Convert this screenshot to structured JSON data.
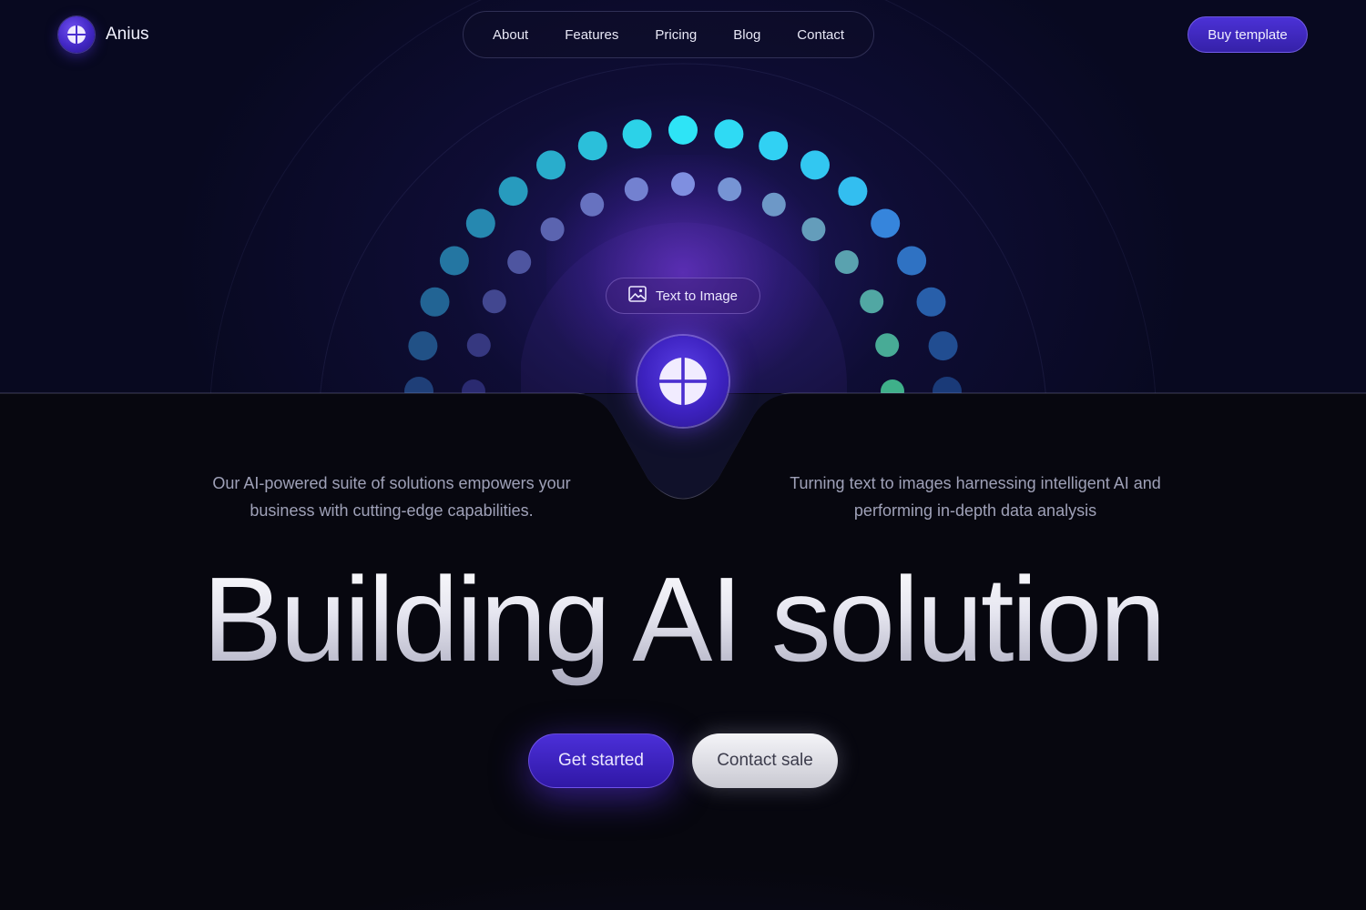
{
  "header": {
    "brand": "Anius",
    "nav": [
      "About",
      "Features",
      "Pricing",
      "Blog",
      "Contact"
    ],
    "cta": "Buy template"
  },
  "hero": {
    "badge": "Text to Image",
    "left_text": "Our AI-powered suite of solutions empowers your business with cutting-edge capabilities.",
    "right_text": "Turning text to images harnessing intelligent AI and performing in-depth data analysis",
    "headline": "Building AI solution",
    "primary_button": "Get started",
    "secondary_button": "Contact sale"
  },
  "colors": {
    "accent": "#4b2fd8",
    "background": "#080920",
    "dot_cyan": "#2ee0f5",
    "dot_violet": "#7b6ef0",
    "dot_green": "#4ab890"
  },
  "icons": [
    "brand-logo-icon",
    "image-icon",
    "orb-logo-icon"
  ]
}
